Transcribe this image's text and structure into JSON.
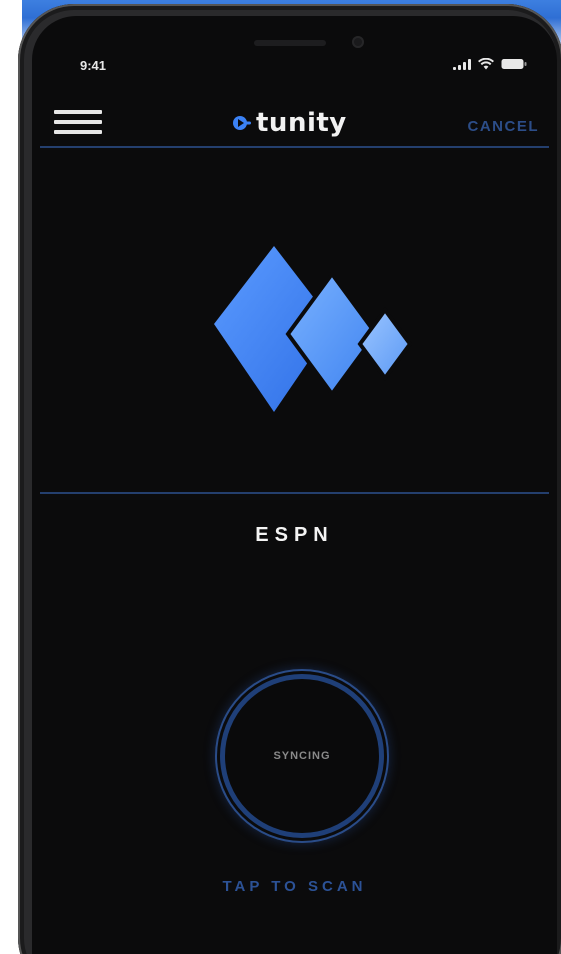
{
  "status_bar": {
    "time": "9:41"
  },
  "nav": {
    "menu_icon": "hamburger-menu-icon",
    "logo_text": "tunity",
    "cancel_label": "CANCEL"
  },
  "channel": {
    "name": "ESPN",
    "logo_icon": "diamonds-logo-icon"
  },
  "sync": {
    "label": "SYNCING",
    "tap_label": "TAP TO SCAN"
  },
  "colors": {
    "screen_background": "#0b0b0c",
    "accent_blue": "#3b82f6",
    "divider": "#243f6e",
    "cancel_text": "#2c4d88",
    "scan_text": "#2c5296"
  }
}
